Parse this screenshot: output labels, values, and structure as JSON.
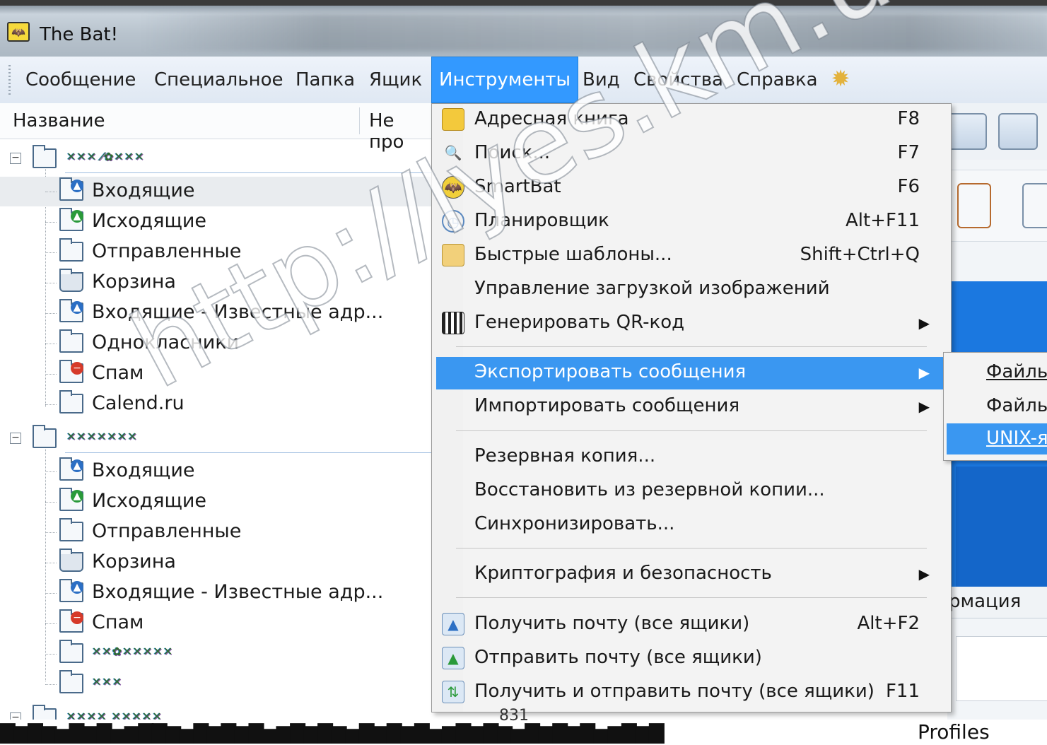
{
  "window": {
    "title": "The Bat!"
  },
  "menubar": {
    "items": [
      {
        "label": "Сообщение",
        "active": false
      },
      {
        "label": "Специальное",
        "active": false
      },
      {
        "label": "Папка",
        "active": false
      },
      {
        "label": "Ящик",
        "active": false
      },
      {
        "label": "Инструменты",
        "active": true
      },
      {
        "label": "Вид",
        "active": false
      },
      {
        "label": "Свойства",
        "active": false
      },
      {
        "label": "Справка",
        "active": false
      }
    ]
  },
  "folder_panel": {
    "col_name": "Название",
    "col_unread": "Не про",
    "accounts": [
      {
        "folders": [
          "Входящие",
          "Исходящие",
          "Отправленные",
          "Корзина",
          "Входящие - Известные адр...",
          "Однокласники",
          "Спам",
          "Calend.ru"
        ]
      },
      {
        "folders": [
          "Входящие",
          "Исходящие",
          "Отправленные",
          "Корзина",
          "Входящие - Известные адр...",
          "Спам"
        ]
      }
    ]
  },
  "tools_menu": {
    "items": [
      {
        "label": "Адресная книга",
        "shortcut": "F8",
        "icon": "address-book-icon"
      },
      {
        "label": "Поиск...",
        "shortcut": "F7",
        "icon": "search-icon"
      },
      {
        "label": "SmartBat",
        "shortcut": "F6",
        "icon": "bat-icon"
      },
      {
        "label": "Планировщик",
        "shortcut": "Alt+F11",
        "icon": "clock-icon"
      },
      {
        "label": "Быстрые шаблоны...",
        "shortcut": "Shift+Ctrl+Q",
        "icon": "template-icon"
      },
      {
        "label": "Управление загрузкой изображений",
        "shortcut": ""
      },
      {
        "label": "Генерировать QR-код",
        "submenu": true,
        "icon": "qr-code-icon"
      },
      {
        "label": "Экспортировать сообщения",
        "submenu": true,
        "highlighted": true
      },
      {
        "label": "Импортировать сообщения",
        "submenu": true
      },
      {
        "label": "Резервная копия...",
        "shortcut": ""
      },
      {
        "label": "Восстановить из резервной копии...",
        "shortcut": ""
      },
      {
        "label": "Синхронизировать...",
        "shortcut": ""
      },
      {
        "label": "Криптография и безопасность",
        "submenu": true
      },
      {
        "label": "Получить почту (все ящики)",
        "shortcut": "Alt+F2",
        "icon": "receive-mail-icon"
      },
      {
        "label": "Отправить почту (все ящики)",
        "shortcut": "",
        "icon": "send-mail-icon"
      },
      {
        "label": "Получить и отправить почту (все ящики)",
        "shortcut": "F11",
        "icon": "send-receive-icon"
      }
    ]
  },
  "export_submenu": {
    "items": [
      {
        "label": "Файлы",
        "highlighted": false
      },
      {
        "label": "Файлы",
        "highlighted": false
      },
      {
        "label": "UNIX-я",
        "highlighted": true
      }
    ]
  },
  "right_panel": {
    "info_label": "рмация"
  },
  "watermark": "http://lyes.km.ua",
  "bottom": {
    "profiles": "Profiles",
    "number": "831"
  },
  "colors": {
    "highlight": "#3a97f1",
    "active_menu": "#3399ff",
    "blue_panel": "#1b78e0"
  }
}
